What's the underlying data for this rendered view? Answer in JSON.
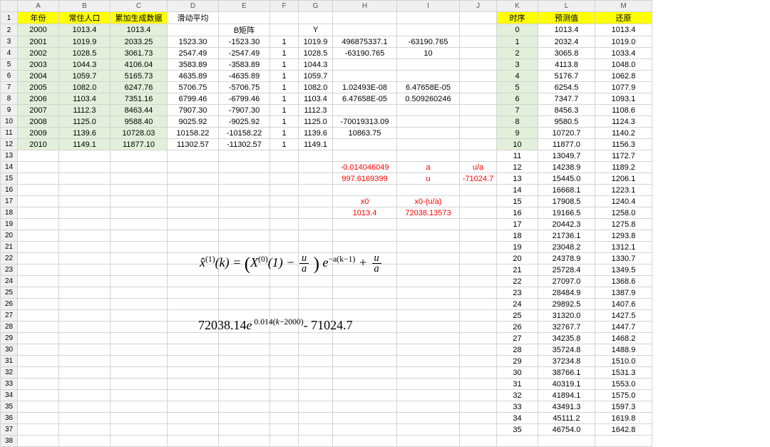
{
  "columns": [
    "",
    "A",
    "B",
    "C",
    "D",
    "E",
    "F",
    "G",
    "H",
    "I",
    "J",
    "K",
    "L",
    "M"
  ],
  "header_row": {
    "A": "年份",
    "B": "常住人口",
    "C": "累加生成数据",
    "D": "滑动平均",
    "K": "时序",
    "L": "预测值",
    "M": "还原"
  },
  "bmatrix_label": "B矩阵",
  "y_label": "Y",
  "rows_abc": [
    {
      "r": 2,
      "A": "2000",
      "B": "1013.4",
      "C": "1013.4"
    },
    {
      "r": 3,
      "A": "2001",
      "B": "1019.9",
      "C": "2033.25"
    },
    {
      "r": 4,
      "A": "2002",
      "B": "1028.5",
      "C": "3061.73"
    },
    {
      "r": 5,
      "A": "2003",
      "B": "1044.3",
      "C": "4106.04"
    },
    {
      "r": 6,
      "A": "2004",
      "B": "1059.7",
      "C": "5165.73"
    },
    {
      "r": 7,
      "A": "2005",
      "B": "1082.0",
      "C": "6247.76"
    },
    {
      "r": 8,
      "A": "2006",
      "B": "1103.4",
      "C": "7351.16"
    },
    {
      "r": 9,
      "A": "2007",
      "B": "1112.3",
      "C": "8463.44"
    },
    {
      "r": 10,
      "A": "2008",
      "B": "1125.0",
      "C": "9588.40"
    },
    {
      "r": 11,
      "A": "2009",
      "B": "1139.6",
      "C": "10728.03"
    },
    {
      "r": 12,
      "A": "2010",
      "B": "1149.1",
      "C": "11877.10"
    }
  ],
  "rows_defg": [
    {
      "r": 3,
      "D": "1523.30",
      "E": "-1523.30",
      "F": "1",
      "G": "1019.9"
    },
    {
      "r": 4,
      "D": "2547.49",
      "E": "-2547.49",
      "F": "1",
      "G": "1028.5"
    },
    {
      "r": 5,
      "D": "3583.89",
      "E": "-3583.89",
      "F": "1",
      "G": "1044.3"
    },
    {
      "r": 6,
      "D": "4635.89",
      "E": "-4635.89",
      "F": "1",
      "G": "1059.7"
    },
    {
      "r": 7,
      "D": "5706.75",
      "E": "-5706.75",
      "F": "1",
      "G": "1082.0"
    },
    {
      "r": 8,
      "D": "6799.46",
      "E": "-6799.46",
      "F": "1",
      "G": "1103.4"
    },
    {
      "r": 9,
      "D": "7907.30",
      "E": "-7907.30",
      "F": "1",
      "G": "1112.3"
    },
    {
      "r": 10,
      "D": "9025.92",
      "E": "-9025.92",
      "F": "1",
      "G": "1125.0"
    },
    {
      "r": 11,
      "D": "10158.22",
      "E": "-10158.22",
      "F": "1",
      "G": "1139.6"
    },
    {
      "r": 12,
      "D": "11302.57",
      "E": "-11302.57",
      "F": "1",
      "G": "1149.1"
    }
  ],
  "hi": [
    {
      "r": 3,
      "H": "496875337.1",
      "I": "-63190.765"
    },
    {
      "r": 4,
      "H": "-63190.765",
      "I": "10"
    },
    {
      "r": 7,
      "H": "1.02493E-08",
      "I": "6.47658E-05"
    },
    {
      "r": 8,
      "H": "6.47658E-05",
      "I": "0.509260246"
    },
    {
      "r": 10,
      "H": "-70019313.09"
    },
    {
      "r": 11,
      "H": "10863.75"
    }
  ],
  "params": [
    {
      "r": 14,
      "H": "-0.014046049",
      "I": "a",
      "J": "u/a"
    },
    {
      "r": 15,
      "H": "997.6169399",
      "I": "u",
      "J": "-71024.7"
    },
    {
      "r": 17,
      "H": "x0",
      "I": "x0-(u/a)"
    },
    {
      "r": 18,
      "H": "1013.4",
      "I": "72038.13573"
    }
  ],
  "klm": [
    {
      "r": 2,
      "K": "0",
      "L": "1013.4",
      "M": "1013.4"
    },
    {
      "r": 3,
      "K": "1",
      "L": "2032.4",
      "M": "1019.0"
    },
    {
      "r": 4,
      "K": "2",
      "L": "3065.8",
      "M": "1033.4"
    },
    {
      "r": 5,
      "K": "3",
      "L": "4113.8",
      "M": "1048.0"
    },
    {
      "r": 6,
      "K": "4",
      "L": "5176.7",
      "M": "1062.8"
    },
    {
      "r": 7,
      "K": "5",
      "L": "6254.5",
      "M": "1077.9"
    },
    {
      "r": 8,
      "K": "6",
      "L": "7347.7",
      "M": "1093.1"
    },
    {
      "r": 9,
      "K": "7",
      "L": "8456.3",
      "M": "1108.6"
    },
    {
      "r": 10,
      "K": "8",
      "L": "9580.5",
      "M": "1124.3"
    },
    {
      "r": 11,
      "K": "9",
      "L": "10720.7",
      "M": "1140.2"
    },
    {
      "r": 12,
      "K": "10",
      "L": "11877.0",
      "M": "1156.3"
    },
    {
      "r": 13,
      "K": "11",
      "L": "13049.7",
      "M": "1172.7"
    },
    {
      "r": 14,
      "K": "12",
      "L": "14238.9",
      "M": "1189.2"
    },
    {
      "r": 15,
      "K": "13",
      "L": "15445.0",
      "M": "1206.1"
    },
    {
      "r": 16,
      "K": "14",
      "L": "16668.1",
      "M": "1223.1"
    },
    {
      "r": 17,
      "K": "15",
      "L": "17908.5",
      "M": "1240.4"
    },
    {
      "r": 18,
      "K": "16",
      "L": "19166.5",
      "M": "1258.0"
    },
    {
      "r": 19,
      "K": "17",
      "L": "20442.3",
      "M": "1275.8"
    },
    {
      "r": 20,
      "K": "18",
      "L": "21736.1",
      "M": "1293.8"
    },
    {
      "r": 21,
      "K": "19",
      "L": "23048.2",
      "M": "1312.1"
    },
    {
      "r": 22,
      "K": "20",
      "L": "24378.9",
      "M": "1330.7"
    },
    {
      "r": 23,
      "K": "21",
      "L": "25728.4",
      "M": "1349.5"
    },
    {
      "r": 24,
      "K": "22",
      "L": "27097.0",
      "M": "1368.6"
    },
    {
      "r": 25,
      "K": "23",
      "L": "28484.9",
      "M": "1387.9"
    },
    {
      "r": 26,
      "K": "24",
      "L": "29892.5",
      "M": "1407.6"
    },
    {
      "r": 27,
      "K": "25",
      "L": "31320.0",
      "M": "1427.5"
    },
    {
      "r": 28,
      "K": "26",
      "L": "32767.7",
      "M": "1447.7"
    },
    {
      "r": 29,
      "K": "27",
      "L": "34235.8",
      "M": "1468.2"
    },
    {
      "r": 30,
      "K": "28",
      "L": "35724.8",
      "M": "1488.9"
    },
    {
      "r": 31,
      "K": "29",
      "L": "37234.8",
      "M": "1510.0"
    },
    {
      "r": 32,
      "K": "30",
      "L": "38766.1",
      "M": "1531.3"
    },
    {
      "r": 33,
      "K": "31",
      "L": "40319.1",
      "M": "1553.0"
    },
    {
      "r": 34,
      "K": "32",
      "L": "41894.1",
      "M": "1575.0"
    },
    {
      "r": 35,
      "K": "33",
      "L": "43491.3",
      "M": "1597.3"
    },
    {
      "r": 36,
      "K": "34",
      "L": "45111.2",
      "M": "1619.8"
    },
    {
      "r": 37,
      "K": "35",
      "L": "46754.0",
      "M": "1642.8"
    }
  ]
}
